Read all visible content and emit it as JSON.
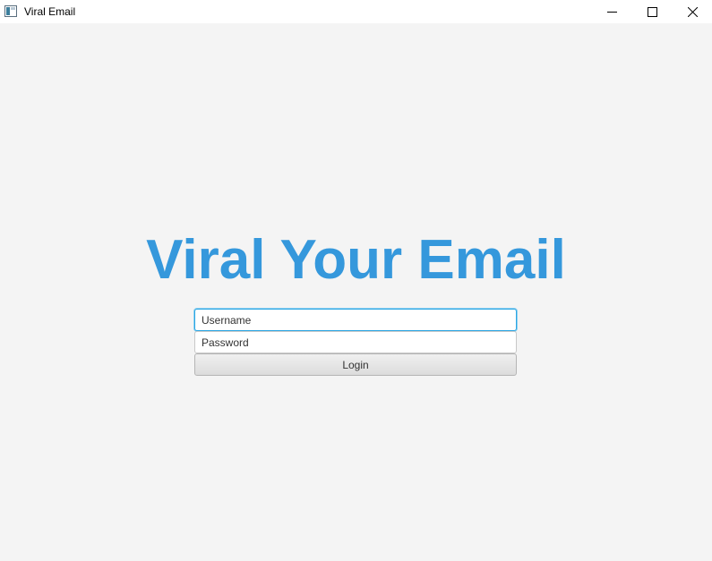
{
  "window": {
    "title": "Viral Email",
    "controls": {
      "minimize": "minimize-icon",
      "maximize": "maximize-icon",
      "close": "close-icon"
    }
  },
  "main": {
    "headline": "Viral Your Email",
    "headline_color": "#3598dc",
    "username": {
      "value": "Username",
      "placeholder": "Username"
    },
    "password": {
      "value": "",
      "placeholder": "Password"
    },
    "login_label": "Login"
  }
}
